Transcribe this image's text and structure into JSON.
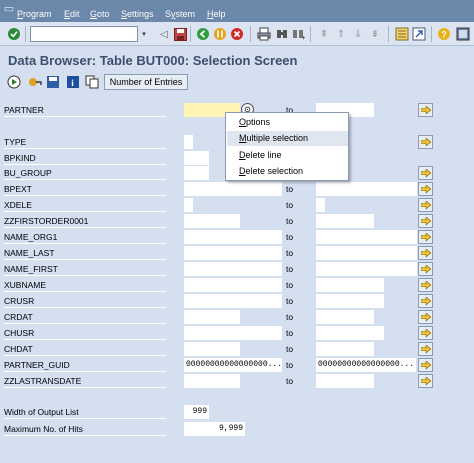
{
  "menubar": {
    "items": [
      {
        "label": "Program",
        "key": "P"
      },
      {
        "label": "Edit",
        "key": "E"
      },
      {
        "label": "Goto",
        "key": "G"
      },
      {
        "label": "Settings",
        "key": "S"
      },
      {
        "label": "System",
        "key": "y"
      },
      {
        "label": "Help",
        "key": "H"
      }
    ]
  },
  "command_field": {
    "value": "",
    "placeholder": ""
  },
  "title": "Data Browser: Table BUT000: Selection Screen",
  "app_toolbar": {
    "number_of_entries_label": "Number of Entries"
  },
  "fields": [
    {
      "label": "PARTNER",
      "low": "",
      "to": "to",
      "high": ""
    },
    {
      "label": "TYPE",
      "low": "",
      "to": "",
      "high": ""
    },
    {
      "label": "BPKIND",
      "low": "",
      "to": "",
      "high": ""
    },
    {
      "label": "BU_GROUP",
      "low": "",
      "to": "",
      "high": ""
    },
    {
      "label": "BPEXT",
      "low": "",
      "to": "to",
      "high": ""
    },
    {
      "label": "XDELE",
      "low": "",
      "to": "to",
      "high": ""
    },
    {
      "label": "ZZFIRSTORDER0001",
      "low": "",
      "to": "to",
      "high": ""
    },
    {
      "label": "NAME_ORG1",
      "low": "",
      "to": "to",
      "high": ""
    },
    {
      "label": "NAME_LAST",
      "low": "",
      "to": "to",
      "high": ""
    },
    {
      "label": "NAME_FIRST",
      "low": "",
      "to": "to",
      "high": ""
    },
    {
      "label": "XUBNAME",
      "low": "",
      "to": "to",
      "high": ""
    },
    {
      "label": "CRUSR",
      "low": "",
      "to": "to",
      "high": ""
    },
    {
      "label": "CRDAT",
      "low": "",
      "to": "to",
      "high": ""
    },
    {
      "label": "CHUSR",
      "low": "",
      "to": "to",
      "high": ""
    },
    {
      "label": "CHDAT",
      "low": "",
      "to": "to",
      "high": ""
    },
    {
      "label": "PARTNER_GUID",
      "low": "00000000000000000...",
      "to": "to",
      "high": "00000000000000000..."
    },
    {
      "label": "ZZLASTRANSDATE",
      "low": "",
      "to": "to",
      "high": ""
    }
  ],
  "output": {
    "width_label": "Width of Output List",
    "width_value": "999",
    "max_hits_label": "Maximum No. of Hits",
    "max_hits_value": "9,999"
  },
  "context_menu": {
    "items": [
      {
        "label": "Options",
        "key": "O"
      },
      {
        "label": "Multiple selection",
        "key": "M"
      },
      {
        "label": "Delete line",
        "key": "D"
      },
      {
        "label": "Delete selection",
        "key": "D"
      }
    ]
  },
  "colors": {
    "menubar": "#6b87a9",
    "background": "#d4dff0",
    "title": "#3b4f6e",
    "focused_field": "#fff4b3"
  }
}
